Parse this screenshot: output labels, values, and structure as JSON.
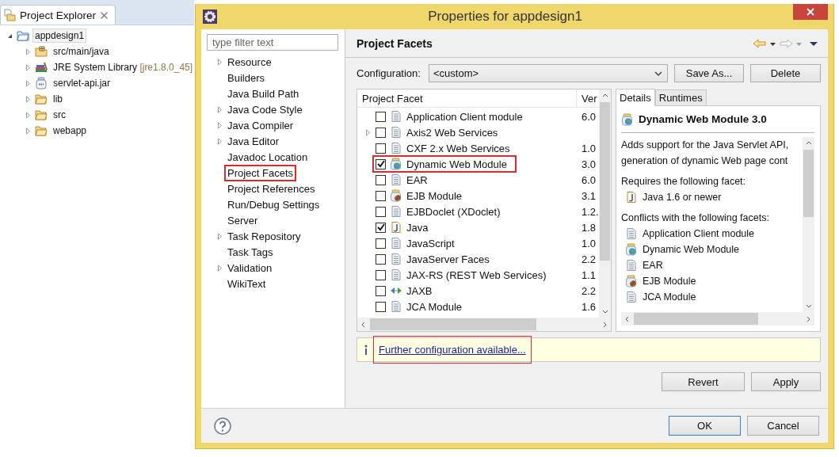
{
  "explorer": {
    "title": "Project Explorer",
    "tree": [
      {
        "label": "appdesign1",
        "kind": "project",
        "expanded": true,
        "selected": true,
        "children": [
          {
            "label": "src/main/java",
            "kind": "package-root",
            "expanded": false,
            "selected": false
          },
          {
            "label": "JRE System Library",
            "decoration": "[jre1.8.0_45]",
            "kind": "library",
            "expanded": false,
            "selected": false
          },
          {
            "label": "servlet-api.jar",
            "kind": "jar",
            "expanded": false,
            "selected": false
          },
          {
            "label": "lib",
            "kind": "folder",
            "expanded": false,
            "selected": false
          },
          {
            "label": "src",
            "kind": "folder",
            "expanded": false,
            "selected": false
          },
          {
            "label": "webapp",
            "kind": "folder",
            "expanded": false,
            "selected": false
          }
        ]
      }
    ]
  },
  "dialog": {
    "title": "Properties for appdesign1",
    "filter": {
      "placeholder": "type filter text"
    },
    "nav": [
      {
        "label": "Resource",
        "expandable": true,
        "marked": false
      },
      {
        "label": "Builders",
        "expandable": false,
        "marked": false
      },
      {
        "label": "Java Build Path",
        "expandable": false,
        "marked": false
      },
      {
        "label": "Java Code Style",
        "expandable": true,
        "marked": false
      },
      {
        "label": "Java Compiler",
        "expandable": true,
        "marked": false
      },
      {
        "label": "Java Editor",
        "expandable": true,
        "marked": false
      },
      {
        "label": "Javadoc Location",
        "expandable": false,
        "marked": false
      },
      {
        "label": "Project Facets",
        "expandable": false,
        "marked": true
      },
      {
        "label": "Project References",
        "expandable": false,
        "marked": false
      },
      {
        "label": "Run/Debug Settings",
        "expandable": false,
        "marked": false
      },
      {
        "label": "Server",
        "expandable": false,
        "marked": false
      },
      {
        "label": "Task Repository",
        "expandable": true,
        "marked": false
      },
      {
        "label": "Task Tags",
        "expandable": false,
        "marked": false
      },
      {
        "label": "Validation",
        "expandable": true,
        "marked": false
      },
      {
        "label": "WikiText",
        "expandable": false,
        "marked": false
      }
    ],
    "page": {
      "title": "Project Facets",
      "configuration": {
        "label": "Configuration:",
        "value": "<custom>"
      },
      "buttons": [
        "Save As...",
        "Delete"
      ],
      "facets": {
        "columns": [
          "Project Facet",
          "Ver"
        ],
        "rows": [
          {
            "name": "Application Client module",
            "version": "6.0",
            "kind": "plain",
            "checked": false,
            "expandable": false,
            "marked": false
          },
          {
            "name": "Axis2 Web Services",
            "kind": "plain",
            "checked": false,
            "expandable": true,
            "marked": false
          },
          {
            "name": "CXF 2.x Web Services",
            "version": "1.0",
            "kind": "plain",
            "checked": false,
            "expandable": false,
            "marked": false
          },
          {
            "name": "Dynamic Web Module",
            "version": "3.0",
            "kind": "web",
            "checked": true,
            "expandable": false,
            "marked": true
          },
          {
            "name": "EAR",
            "version": "6.0",
            "kind": "plain",
            "checked": false,
            "expandable": false,
            "marked": false
          },
          {
            "name": "EJB Module",
            "version": "3.1",
            "kind": "ejb",
            "checked": false,
            "expandable": false,
            "marked": false
          },
          {
            "name": "EJBDoclet (XDoclet)",
            "version": "1.2.",
            "kind": "plain",
            "checked": false,
            "expandable": false,
            "marked": false
          },
          {
            "name": "Java",
            "version": "1.8",
            "kind": "java",
            "checked": true,
            "expandable": false,
            "marked": false
          },
          {
            "name": "JavaScript",
            "version": "1.0",
            "kind": "plain",
            "checked": false,
            "expandable": false,
            "marked": false
          },
          {
            "name": "JavaServer Faces",
            "version": "2.2",
            "kind": "plain",
            "checked": false,
            "expandable": false,
            "marked": false
          },
          {
            "name": "JAX-RS (REST Web Services)",
            "version": "1.1",
            "kind": "plain",
            "checked": false,
            "expandable": false,
            "marked": false
          },
          {
            "name": "JAXB",
            "version": "2.2",
            "kind": "binding",
            "checked": false,
            "expandable": false,
            "marked": false
          },
          {
            "name": "JCA Module",
            "version": "1.6",
            "kind": "plain",
            "checked": false,
            "expandable": false,
            "marked": false
          }
        ]
      },
      "details": {
        "tabs": [
          {
            "label": "Details",
            "selected": true
          },
          {
            "label": "Runtimes",
            "selected": false
          }
        ],
        "title": {
          "text": "Dynamic Web Module 3.0",
          "kind": "web"
        },
        "lines": [
          {
            "kind": "text",
            "text": "Adds support for the Java Servlet API,"
          },
          {
            "kind": "text",
            "text": "generation of dynamic Web page cont"
          },
          {
            "kind": "heading",
            "text": "Requires the following facet:"
          },
          {
            "kind": "java",
            "text": "Java 1.6 or newer"
          },
          {
            "kind": "heading",
            "text": "Conflicts with the following facets:"
          },
          {
            "kind": "plain",
            "text": "Application Client module"
          },
          {
            "kind": "web",
            "text": "Dynamic Web Module"
          },
          {
            "kind": "plain",
            "text": "EAR"
          },
          {
            "kind": "ejb",
            "text": "EJB Module"
          },
          {
            "kind": "plain",
            "text": "JCA Module"
          }
        ]
      },
      "info": {
        "link": "Further configuration available...",
        "marked": true
      },
      "actions": [
        "Revert",
        "Apply"
      ]
    },
    "footer": {
      "buttons": [
        {
          "label": "OK",
          "default": true
        },
        {
          "label": "Cancel",
          "default": false
        }
      ]
    }
  }
}
